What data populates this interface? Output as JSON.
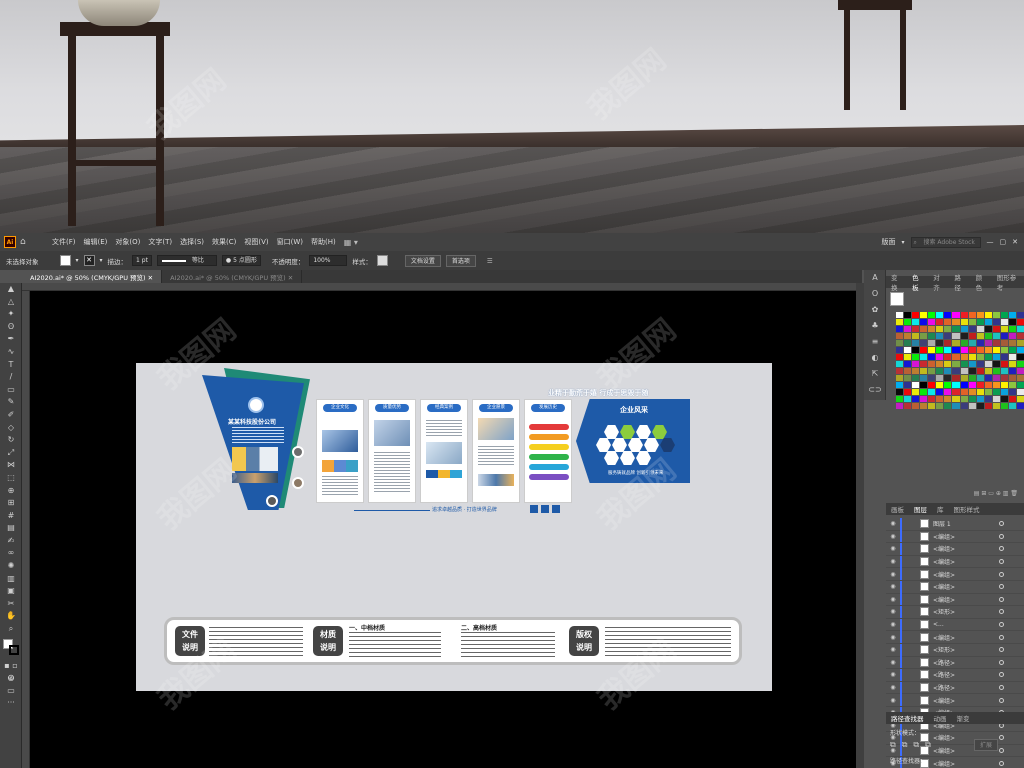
{
  "menubar": {
    "app_badge": "Ai",
    "items": [
      "文件(F)",
      "编辑(E)",
      "对象(O)",
      "文字(T)",
      "选择(S)",
      "效果(C)",
      "视图(V)",
      "窗口(W)",
      "帮助(H)"
    ],
    "workspace": "版面",
    "search_placeholder": "搜索 Adobe Stock"
  },
  "controlbar": {
    "selection": "未选择对象",
    "stroke_label": "描边：",
    "stroke_value": "1 pt",
    "stroke_style": "等比",
    "brush": "5 点圆形",
    "opacity_label": "不透明度：",
    "opacity_value": "100%",
    "style_label": "样式：",
    "doc_settings": "文档设置",
    "preferences": "首选项"
  },
  "tabs": [
    {
      "label": "AI2020.ai* @ 50% (CMYK/GPU 预览)",
      "active": true
    },
    {
      "label": "AI2020.ai* @ 50% (CMYK/GPU 预览)",
      "active": false
    }
  ],
  "panels": {
    "color_tabs": [
      "变换",
      "色板",
      "对齐",
      "路径",
      "颜色",
      "图形参考"
    ],
    "layer_tabs": [
      "画板",
      "图层",
      "库",
      "图形样式"
    ],
    "layer_rows": [
      "图层 1",
      "<编组>",
      "<编组>",
      "<编组>",
      "<编组>",
      "<编组>",
      "<编组>",
      "<矩形>",
      "<...",
      "<编组>",
      "<矩形>",
      "<路径>",
      "<路径>",
      "<路径>",
      "<编组>",
      "<编组>",
      "<编组>",
      "<编组>",
      "<编组>",
      "<编组>",
      "<编组>"
    ],
    "pathfinder_tabs": [
      "路径查找器",
      "动画",
      "渐变"
    ],
    "pathfinder_label": "形状模式：",
    "pathfinder_label2": "路径查找器：",
    "expand_btn": "扩展",
    "swatch_colors": [
      "#ffffff",
      "#000000",
      "#ff0000",
      "#ffff00",
      "#00ff00",
      "#00ffff",
      "#0000ff",
      "#ff00ff",
      "#ee1d24",
      "#f26522",
      "#f7941d",
      "#fff200",
      "#8dc63f",
      "#00a651",
      "#00aeef",
      "#2e3192"
    ]
  },
  "design": {
    "company": "某某科技股份公司",
    "slogan_top": "业精于勤荒于嬉  行成于思毁于随",
    "culture_title": "企业风采",
    "culture_sub": "服务铸就品牌  创新引领未来",
    "center_slogan": "追求卓越品质 · 打造世界品牌",
    "panel_titles": [
      "企业文化",
      "质量优势",
      "经典案例",
      "企业愿景",
      "发展历史"
    ],
    "bottom_labels": [
      "文件\n说明",
      "材质\n说明",
      "版权\n说明"
    ],
    "material_1": "一、中档材质",
    "material_2": "二、高档材质"
  }
}
